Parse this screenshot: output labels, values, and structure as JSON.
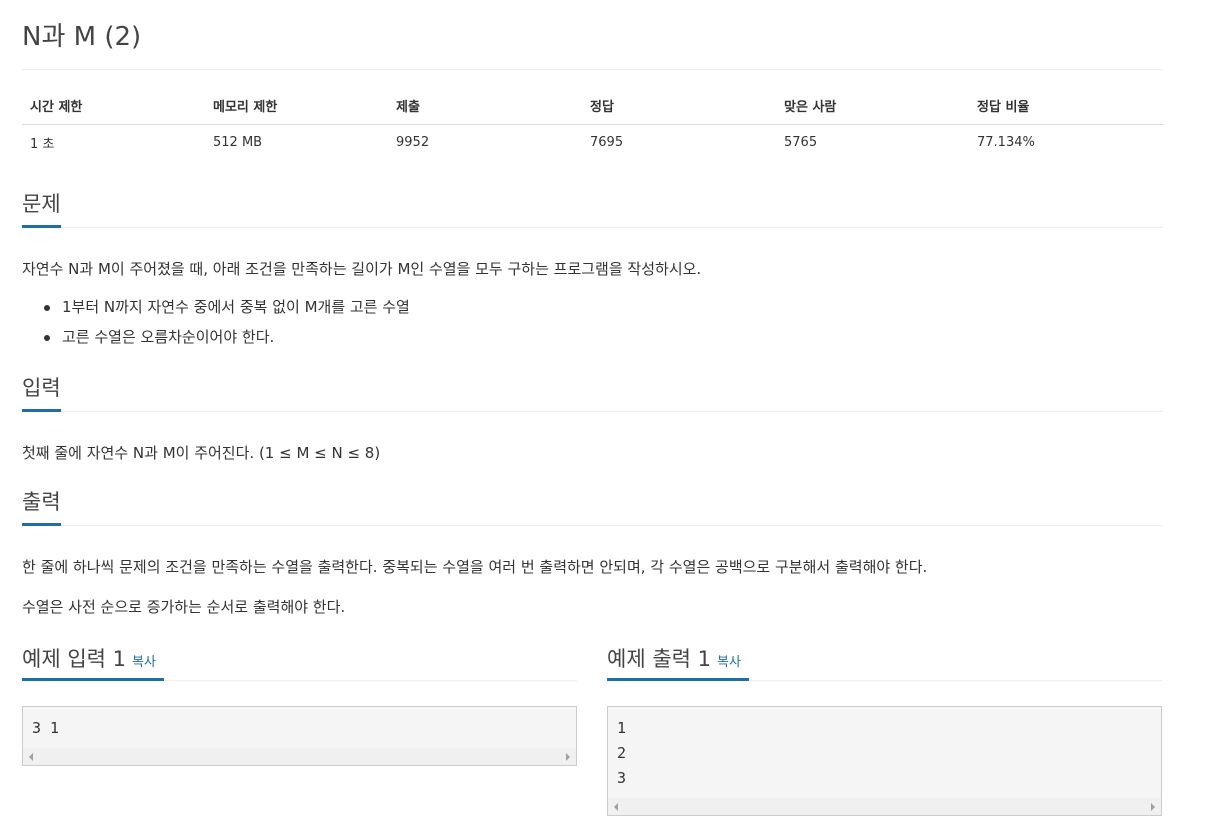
{
  "problem": {
    "title": "N과 M (2)"
  },
  "info": {
    "headers": [
      "시간 제한",
      "메모리 제한",
      "제출",
      "정답",
      "맞은 사람",
      "정답 비율"
    ],
    "values": [
      "1 초",
      "512 MB",
      "9952",
      "7695",
      "5765",
      "77.134%"
    ]
  },
  "description": {
    "heading": "문제",
    "text": "자연수 N과 M이 주어졌을 때, 아래 조건을 만족하는 길이가 M인 수열을 모두 구하는 프로그램을 작성하시오.",
    "bullets": [
      "1부터 N까지 자연수 중에서 중복 없이 M개를 고른 수열",
      "고른 수열은 오름차순이어야 한다."
    ]
  },
  "input": {
    "heading": "입력",
    "text": "첫째 줄에 자연수 N과 M이 주어진다. (1 ≤ M ≤ N ≤ 8)"
  },
  "output": {
    "heading": "출력",
    "text1": "한 줄에 하나씩 문제의 조건을 만족하는 수열을 출력한다. 중복되는 수열을 여러 번 출력하면 안되며, 각 수열은 공백으로 구분해서 출력해야 한다.",
    "text2": "수열은 사전 순으로 증가하는 순서로 출력해야 한다."
  },
  "samples": {
    "input_heading": "예제 입력 1",
    "output_heading": "예제 출력 1",
    "copy_label": "복사",
    "input_lines": [
      "3 1"
    ],
    "output_lines": [
      "1",
      "2",
      "3"
    ]
  },
  "colors": {
    "accent": "#1e6ea7",
    "box_bg": "#f5f5f5"
  }
}
